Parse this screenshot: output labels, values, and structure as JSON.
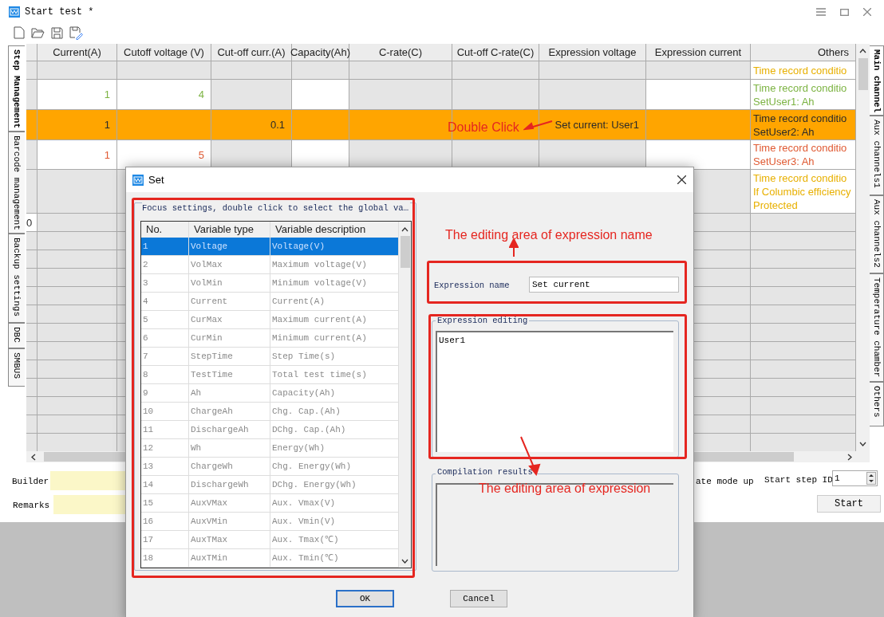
{
  "window": {
    "title": "Start test *"
  },
  "left_tabs": [
    {
      "label": "Step Management",
      "selected": true
    },
    {
      "label": "Barcode management",
      "selected": false
    },
    {
      "label": "Backup settings",
      "selected": false
    },
    {
      "label": "DBC",
      "selected": false
    },
    {
      "label": "SMBUS",
      "selected": false
    }
  ],
  "right_tabs": [
    {
      "label": "Main channel",
      "selected": true
    },
    {
      "label": "Aux channels1",
      "selected": false
    },
    {
      "label": "Aux channels2",
      "selected": false
    },
    {
      "label": "Temperature chamber",
      "selected": false
    },
    {
      "label": "Others",
      "selected": false
    }
  ],
  "grid": {
    "columns": [
      "",
      "Current(A)",
      "Cutoff voltage (V)",
      "Cut-off curr.(A)",
      "Capacity(Ah)",
      "C-rate(C)",
      "Cut-off C-rate(C)",
      "Expression voltage",
      "Expression current",
      "Others"
    ],
    "rows": [
      {
        "kind": "condition",
        "selected": false,
        "color": "#e8b000",
        "cells": [
          "",
          "",
          "",
          "",
          "",
          "",
          "",
          "",
          "",
          [
            "Time record conditio"
          ]
        ]
      },
      {
        "kind": "step",
        "selected": false,
        "color": "#7cb342",
        "cells": [
          "",
          "1",
          "4",
          "",
          "",
          "",
          "",
          "",
          "",
          [
            "Time record conditio",
            "SetUser1: Ah"
          ]
        ]
      },
      {
        "kind": "step",
        "selected": true,
        "cells": [
          "",
          "1",
          "",
          "0.1",
          "",
          "",
          "",
          "Set current: User1",
          "",
          [
            "Time record conditio",
            "SetUser2: Ah"
          ]
        ]
      },
      {
        "kind": "step",
        "selected": false,
        "color": "#e05a33",
        "cells": [
          "",
          "1",
          "5",
          "",
          "",
          "",
          "",
          "",
          "",
          [
            "Time record conditio",
            "SetUser3: Ah"
          ]
        ]
      },
      {
        "kind": "condition",
        "selected": false,
        "color": "#e8b000",
        "cells": [
          "",
          "",
          "",
          "",
          "",
          "",
          "",
          "",
          "",
          [
            "Time record conditio",
            "If Columbic efficiency",
            "Protected"
          ]
        ]
      },
      {
        "kind": "marker",
        "selected": false,
        "cells": [
          "0",
          "",
          "",
          "",
          "",
          "",
          "",
          "",
          "",
          ""
        ]
      }
    ]
  },
  "footer": {
    "builder_label": "Builder",
    "remarks_label": "Remarks",
    "mode_text": "ate mode up",
    "start_step_label": "Start step ID",
    "start_step_value": "1",
    "start_button": "Start"
  },
  "dialog": {
    "title": "Set",
    "hint": "Focus settings, double click to select the global va…",
    "columns": [
      "No.",
      "Variable type",
      "Variable description"
    ],
    "variables": [
      {
        "no": "1",
        "type": "Voltage",
        "description": "Voltage(V)",
        "selected": true
      },
      {
        "no": "2",
        "type": "VolMax",
        "description": "Maximum voltage(V)",
        "selected": false
      },
      {
        "no": "3",
        "type": "VolMin",
        "description": "Minimum voltage(V)",
        "selected": false
      },
      {
        "no": "4",
        "type": "Current",
        "description": "Current(A)",
        "selected": false
      },
      {
        "no": "5",
        "type": "CurMax",
        "description": "Maximum current(A)",
        "selected": false
      },
      {
        "no": "6",
        "type": "CurMin",
        "description": "Minimum current(A)",
        "selected": false
      },
      {
        "no": "7",
        "type": "StepTime",
        "description": "Step Time(s)",
        "selected": false
      },
      {
        "no": "8",
        "type": "TestTime",
        "description": "Total test time(s)",
        "selected": false
      },
      {
        "no": "9",
        "type": "Ah",
        "description": "Capacity(Ah)",
        "selected": false
      },
      {
        "no": "10",
        "type": "ChargeAh",
        "description": "Chg. Cap.(Ah)",
        "selected": false
      },
      {
        "no": "11",
        "type": "DischargeAh",
        "description": "DChg. Cap.(Ah)",
        "selected": false
      },
      {
        "no": "12",
        "type": "Wh",
        "description": "Energy(Wh)",
        "selected": false
      },
      {
        "no": "13",
        "type": "ChargeWh",
        "description": "Chg. Energy(Wh)",
        "selected": false
      },
      {
        "no": "14",
        "type": "DischargeWh",
        "description": "DChg. Energy(Wh)",
        "selected": false
      },
      {
        "no": "15",
        "type": "AuxVMax",
        "description": "Aux. Vmax(V)",
        "selected": false
      },
      {
        "no": "16",
        "type": "AuxVMin",
        "description": "Aux. Vmin(V)",
        "selected": false
      },
      {
        "no": "17",
        "type": "AuxTMax",
        "description": "Aux. Tmax(℃)",
        "selected": false
      },
      {
        "no": "18",
        "type": "AuxTMin",
        "description": "Aux. Tmin(℃)",
        "selected": false
      }
    ],
    "name_label": "Expression name",
    "name_value": "Set current",
    "editing_label": "Expression editing",
    "editing_value": "User1",
    "results_label": "Compilation results",
    "ok_button": "OK",
    "cancel_button": "Cancel"
  },
  "annotations": [
    {
      "kind": "double_click",
      "text": "Double Click"
    },
    {
      "kind": "name_area",
      "text": "The editing area of expression name"
    },
    {
      "kind": "expression_area",
      "text": "The editing area of expression"
    }
  ]
}
